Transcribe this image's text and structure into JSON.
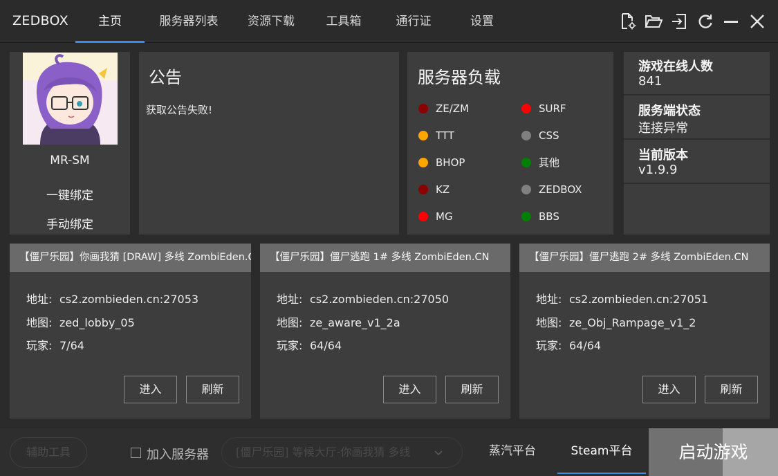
{
  "app": {
    "title": "ZEDBOX"
  },
  "nav": {
    "tabs": [
      {
        "label": "主页",
        "active": true
      },
      {
        "label": "服务器列表"
      },
      {
        "label": "资源下载"
      },
      {
        "label": "工具箱"
      },
      {
        "label": "通行证"
      },
      {
        "label": "设置"
      }
    ]
  },
  "toolbar": {
    "icons": [
      "file-settings-icon",
      "folder-open-icon",
      "login-icon",
      "refresh-icon",
      "minimize-icon",
      "close-icon"
    ]
  },
  "user": {
    "name": "MR-SM",
    "bind_one_click": "一键绑定",
    "bind_manual": "手动绑定"
  },
  "notice": {
    "title": "公告",
    "text": "获取公告失败!"
  },
  "server_load": {
    "title": "服务器负载",
    "items": [
      {
        "label": "ZE/ZM",
        "color": "#8b0000"
      },
      {
        "label": "SURF",
        "color": "#ff0000"
      },
      {
        "label": "TTT",
        "color": "#ffa500"
      },
      {
        "label": "CSS",
        "color": "#808080"
      },
      {
        "label": "BHOP",
        "color": "#ffa500"
      },
      {
        "label": "其他",
        "color": "#008000"
      },
      {
        "label": "KZ",
        "color": "#8b0000"
      },
      {
        "label": "ZEDBOX",
        "color": "#808080"
      },
      {
        "label": "MG",
        "color": "#ff0000"
      },
      {
        "label": "BBS",
        "color": "#008000"
      }
    ]
  },
  "stats": {
    "online_label": "游戏在线人数",
    "online_value": "841",
    "server_status_label": "服务端状态",
    "server_status_value": "连接异常",
    "version_label": "当前版本",
    "version_value": "v1.9.9"
  },
  "servers": [
    {
      "name": "【僵尸乐园】你画我猜 [DRAW] 多线 ZombiEden.CN",
      "address_label": "地址:",
      "address": "cs2.zombieden.cn:27053",
      "map_label": "地图:",
      "map": "zed_lobby_05",
      "players_label": "玩家:",
      "players": "7/64",
      "enter": "进入",
      "refresh": "刷新"
    },
    {
      "name": "【僵尸乐园】僵尸逃跑 1# 多线 ZombiEden.CN",
      "address_label": "地址:",
      "address": "cs2.zombieden.cn:27050",
      "map_label": "地图:",
      "map": "ze_aware_v1_2a",
      "players_label": "玩家:",
      "players": "64/64",
      "enter": "进入",
      "refresh": "刷新"
    },
    {
      "name": "【僵尸乐园】僵尸逃跑 2# 多线 ZombiEden.CN",
      "address_label": "地址:",
      "address": "cs2.zombieden.cn:27051",
      "map_label": "地图:",
      "map": "ze_Obj_Rampage_v1_2",
      "players_label": "玩家:",
      "players": "64/64",
      "enter": "进入",
      "refresh": "刷新"
    }
  ],
  "bottom": {
    "helper": "辅助工具",
    "join_server": "加入服务器",
    "join_checked": false,
    "selected_server": "[僵尸乐园] 等候大厅-你画我猜 多线",
    "platform_steam_cn": "蒸汽平台",
    "platform_steam": "Steam平台",
    "active_platform": "Steam平台",
    "launch": "启动游戏"
  }
}
